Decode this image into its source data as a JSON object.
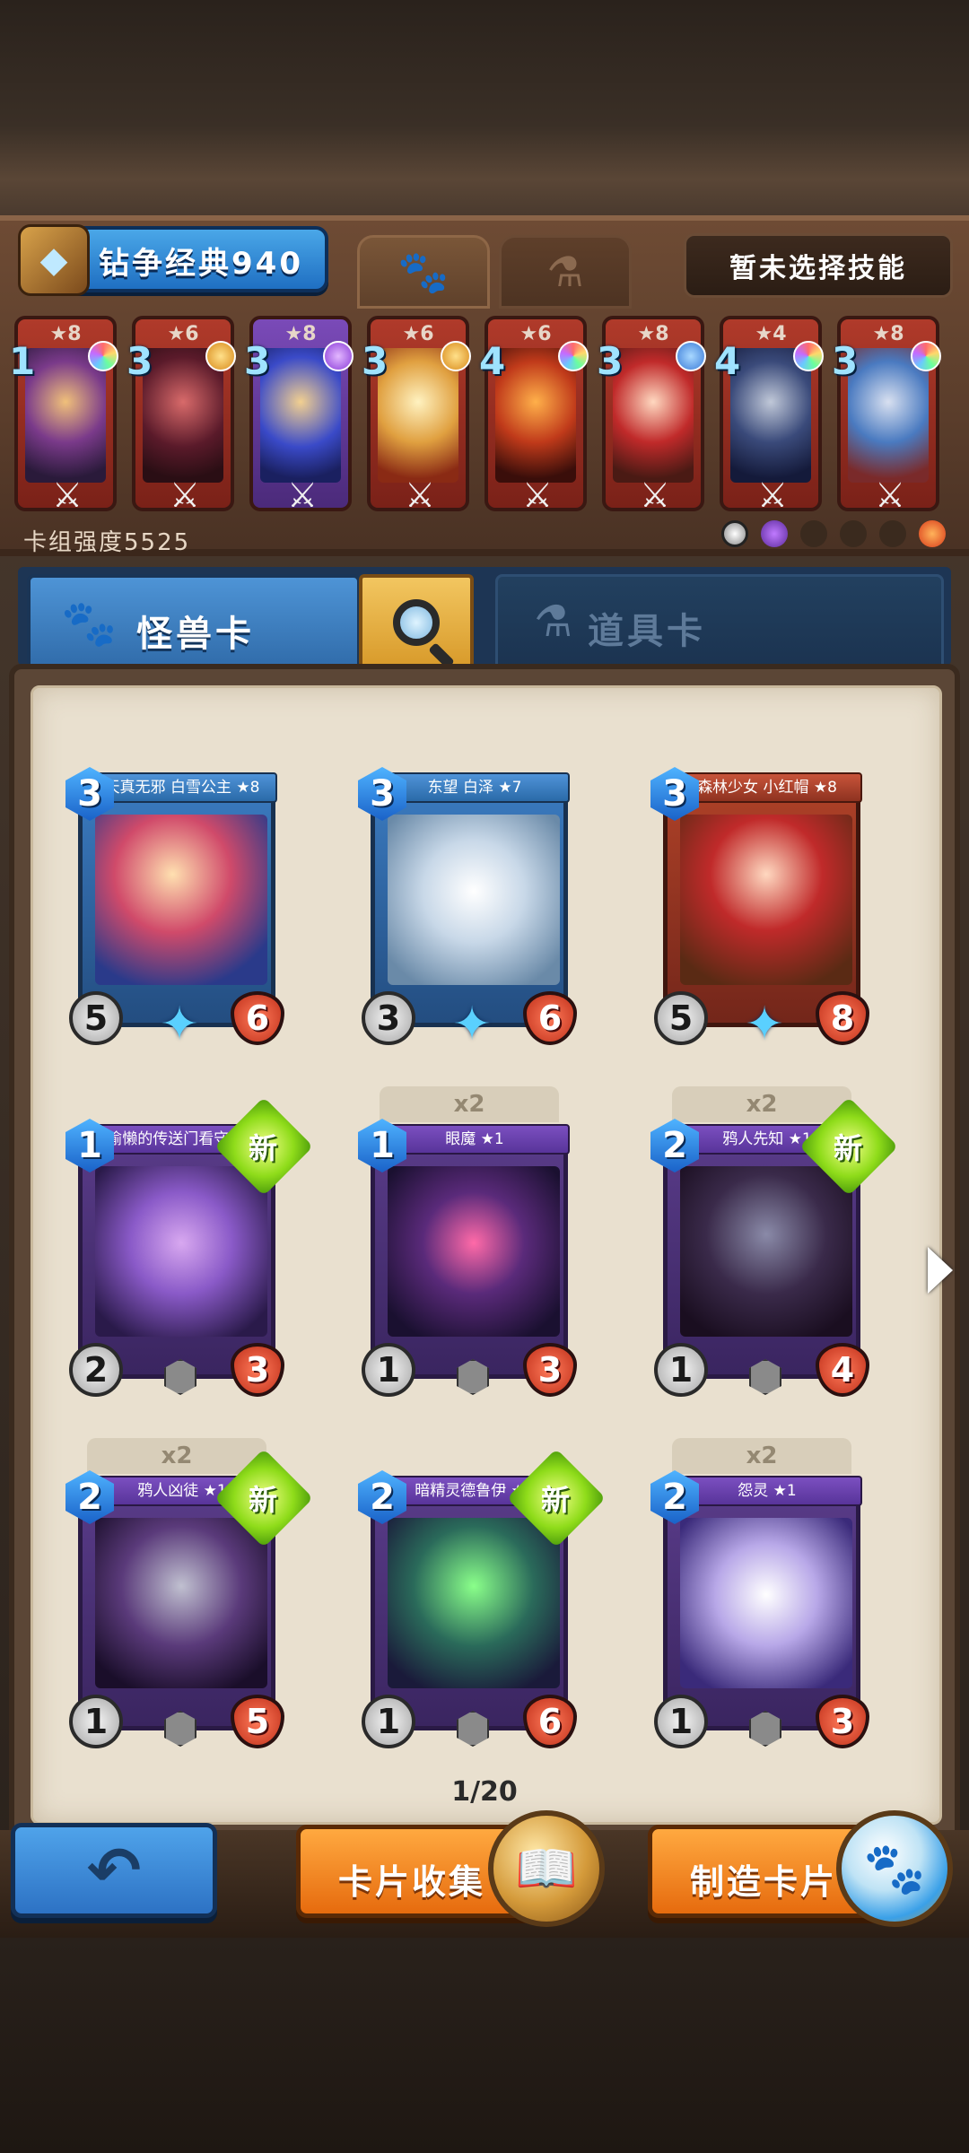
{
  "deck": {
    "name": "钻争经典940",
    "skill_button": "暂未选择技能",
    "power_label": "卡组强度5525",
    "cards": [
      {
        "cost": "1",
        "stars": "★8",
        "gem": "rainbow",
        "frame": "red"
      },
      {
        "cost": "3",
        "stars": "★6",
        "gem": "gold",
        "frame": "red"
      },
      {
        "cost": "3",
        "stars": "★8",
        "gem": "purple",
        "frame": "purple"
      },
      {
        "cost": "3",
        "stars": "★6",
        "gem": "gold",
        "frame": "red"
      },
      {
        "cost": "4",
        "stars": "★6",
        "gem": "rainbow",
        "frame": "red"
      },
      {
        "cost": "3",
        "stars": "★8",
        "gem": "blue",
        "frame": "red"
      },
      {
        "cost": "4",
        "stars": "★4",
        "gem": "rainbow",
        "frame": "red"
      },
      {
        "cost": "3",
        "stars": "★8",
        "gem": "rainbow",
        "frame": "red"
      }
    ]
  },
  "tabs": {
    "monster_label": "怪兽卡",
    "item_label": "道具卡"
  },
  "collection": {
    "cards": [
      {
        "name": "天真无邪 白雪公主 ★8",
        "cost": "3",
        "atk": "5",
        "hp": "6",
        "style": "blue",
        "copies": "",
        "is_new": false
      },
      {
        "name": "东望 白泽 ★7",
        "cost": "3",
        "atk": "3",
        "hp": "6",
        "style": "blue",
        "copies": "",
        "is_new": false
      },
      {
        "name": "森林少女 小红帽 ★8",
        "cost": "3",
        "atk": "5",
        "hp": "8",
        "style": "red",
        "copies": "",
        "is_new": false
      },
      {
        "name": "偷懒的传送门看守 ★1",
        "cost": "1",
        "atk": "2",
        "hp": "3",
        "style": "epic",
        "copies": "",
        "is_new": true
      },
      {
        "name": "眼魔 ★1",
        "cost": "1",
        "atk": "1",
        "hp": "3",
        "style": "epic",
        "copies": "x2",
        "is_new": false
      },
      {
        "name": "鸦人先知 ★1",
        "cost": "2",
        "atk": "1",
        "hp": "4",
        "style": "epic",
        "copies": "x2",
        "is_new": true
      },
      {
        "name": "鸦人凶徒 ★1",
        "cost": "2",
        "atk": "1",
        "hp": "5",
        "style": "epic",
        "copies": "x2",
        "is_new": true
      },
      {
        "name": "暗精灵德鲁伊 ★1",
        "cost": "2",
        "atk": "1",
        "hp": "6",
        "style": "epic",
        "copies": "",
        "is_new": true
      },
      {
        "name": "怨灵 ★1",
        "cost": "2",
        "atk": "1",
        "hp": "3",
        "style": "epic",
        "copies": "x2",
        "is_new": false
      }
    ],
    "new_badge": "新",
    "pager": "1/20"
  },
  "buttons": {
    "collect": "卡片收集",
    "craft": "制造卡片"
  },
  "colors": {
    "accent_blue": "#2f6aa8",
    "accent_orange": "#e66b0e",
    "new_green": "#8fdc1a"
  }
}
